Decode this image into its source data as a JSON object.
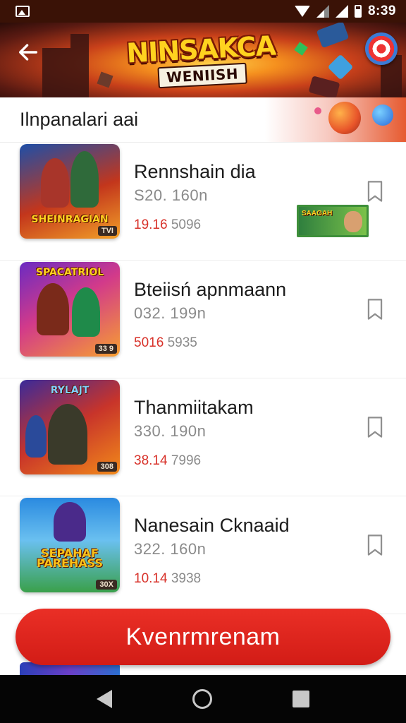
{
  "status_bar": {
    "time": "8:39",
    "icons": [
      "photo-icon",
      "wifi-icon",
      "signal-icon",
      "signal-icon",
      "battery-icon"
    ]
  },
  "header": {
    "logo_main": "NINSAKCA",
    "logo_sub": "WENIISH",
    "back_icon": "arrow-left-icon"
  },
  "section": {
    "title": "Ilnpanalari aai"
  },
  "games": [
    {
      "name": "Rennshain dia",
      "size": "S20. 160n",
      "stats_highlight": "19.16",
      "stats_rest": "5096",
      "thumb_title": "SHEINRAGIAN",
      "thumb_tag": "TVI"
    },
    {
      "name": "Bteiisń apnmaann",
      "size": "032. 199n",
      "stats_highlight": "5016",
      "stats_rest": "5935",
      "thumb_title": "SPACATRIOL",
      "thumb_tag": "33 9"
    },
    {
      "name": "Thanmiitakam",
      "size": "330. 190n",
      "stats_highlight": "38.14",
      "stats_rest": "7996",
      "thumb_title": "RYLAJT",
      "thumb_tag": "308"
    },
    {
      "name": "Nanesain Cknaaid",
      "size": "322. 160n",
      "stats_highlight": "10.14",
      "stats_rest": "3938",
      "thumb_title": "SEPAHAF PAREHASS",
      "thumb_tag": "30X"
    }
  ],
  "promo": {
    "text": "SAAGAH"
  },
  "cta": {
    "label": "Kvenrmrenam"
  },
  "nav": {
    "icons": [
      "back-triangle-icon",
      "home-circle-icon",
      "recents-square-icon"
    ]
  },
  "colors": {
    "accent_red": "#d8322a",
    "cta_red": "#e0241c",
    "header_dark": "#3a1206",
    "logo_yellow": "#ffd21f"
  }
}
